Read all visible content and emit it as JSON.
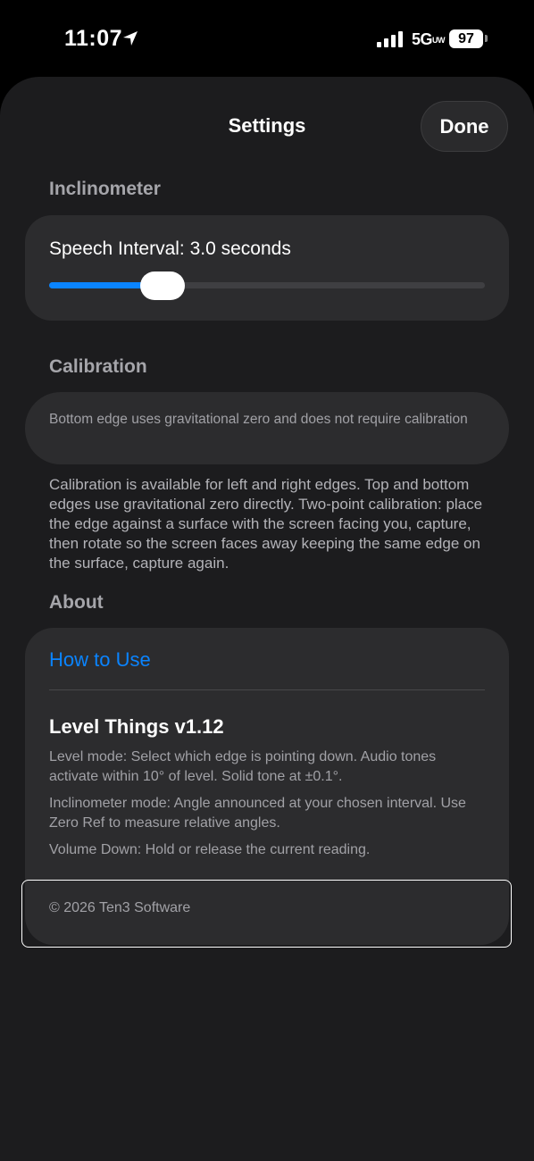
{
  "status_bar": {
    "time": "11:07",
    "network": "5G",
    "network_suffix": "UW",
    "battery": "97",
    "icons": [
      "location-arrow-icon",
      "cellular-signal-icon",
      "battery-icon"
    ]
  },
  "header": {
    "title": "Settings",
    "done_label": "Done"
  },
  "inclinometer": {
    "section_title": "Inclinometer",
    "speech_interval_label": "Speech Interval: 3.0 seconds",
    "slider_fraction": 0.26
  },
  "calibration": {
    "section_title": "Calibration",
    "note": "Bottom edge uses gravitational zero and does not require calibration",
    "footer": "Calibration is available for left and right edges. Top and bottom edges use gravitational zero directly. Two-point calibration: place the edge against a surface with the screen facing you, capture, then rotate so the screen faces away keeping the same edge on the surface, capture again."
  },
  "about": {
    "section_title": "About",
    "how_to_use": "How to Use",
    "app_name": "Level Things v1.12",
    "level_mode": "Level mode: Select which edge is pointing down. Audio tones activate within 10° of level. Solid tone at ±0.1°.",
    "inclinometer_mode": "Inclinometer mode: Angle announced at your chosen interval. Use Zero Ref to measure relative angles.",
    "volume_down": "Volume Down: Hold or release the current reading.",
    "copyright": "© 2026 Ten3 Software"
  },
  "colors": {
    "accent": "#0a84ff",
    "sheet_background": "#1c1c1e",
    "card_background": "#2c2c2e"
  }
}
